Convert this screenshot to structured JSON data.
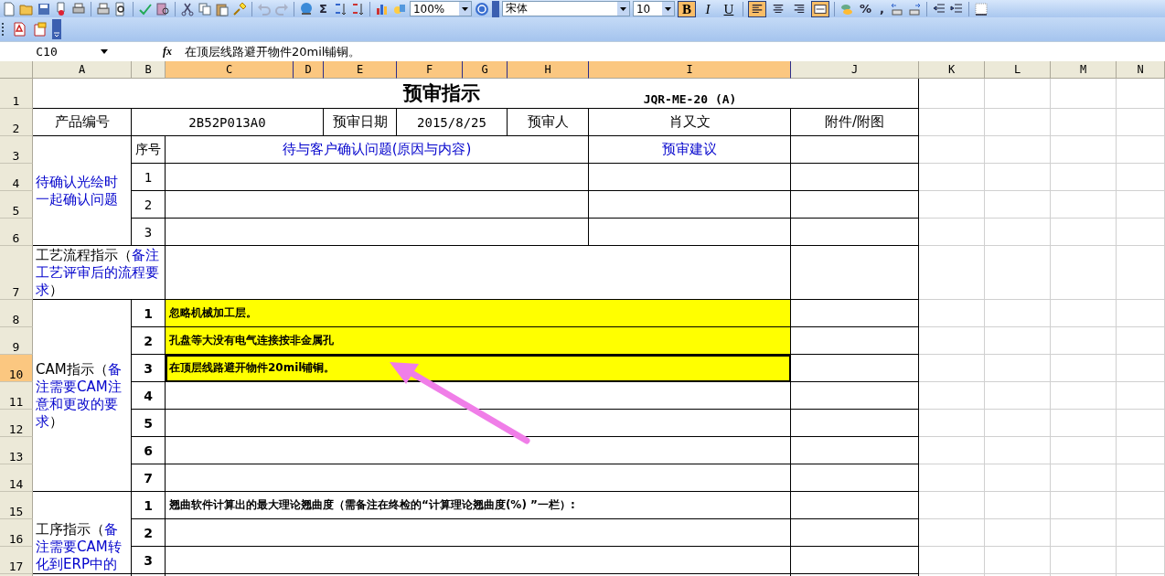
{
  "toolbar": {
    "sum_symbol": "Σ",
    "zoom": "100%",
    "font_name": "宋体",
    "font_size": "10",
    "style_buttons": [
      {
        "label": "B",
        "selected": true
      },
      {
        "label": "I",
        "selected": false
      },
      {
        "label": "U",
        "selected": false
      }
    ],
    "align_buttons": [
      {
        "kind": "left",
        "selected": true
      },
      {
        "kind": "center",
        "selected": false
      },
      {
        "kind": "right",
        "selected": false
      },
      {
        "kind": "merge",
        "selected": true
      }
    ],
    "number_buttons": [
      "%",
      ","
    ]
  },
  "formula_bar": {
    "name_box": "C10",
    "fx": "fx",
    "formula": "在顶层线路避开物件20mil铺铜。"
  },
  "columns": [
    {
      "label": "A",
      "selected": false
    },
    {
      "label": "B",
      "selected": false
    },
    {
      "label": "C",
      "selected": true
    },
    {
      "label": "D",
      "selected": true
    },
    {
      "label": "E",
      "selected": true
    },
    {
      "label": "F",
      "selected": true
    },
    {
      "label": "G",
      "selected": true
    },
    {
      "label": "H",
      "selected": true
    },
    {
      "label": "I",
      "selected": true
    },
    {
      "label": "J",
      "selected": false
    },
    {
      "label": "K",
      "selected": false
    },
    {
      "label": "L",
      "selected": false
    },
    {
      "label": "M",
      "selected": false
    },
    {
      "label": "N",
      "selected": false
    }
  ],
  "rows": [
    {
      "label": "1",
      "selected": false
    },
    {
      "label": "2",
      "selected": false
    },
    {
      "label": "3",
      "selected": false
    },
    {
      "label": "4",
      "selected": false
    },
    {
      "label": "5",
      "selected": false
    },
    {
      "label": "6",
      "selected": false
    },
    {
      "label": "7",
      "selected": false
    },
    {
      "label": "8",
      "selected": false
    },
    {
      "label": "9",
      "selected": false
    },
    {
      "label": "10",
      "selected": true
    },
    {
      "label": "11",
      "selected": false
    },
    {
      "label": "12",
      "selected": false
    },
    {
      "label": "13",
      "selected": false
    },
    {
      "label": "14",
      "selected": false
    },
    {
      "label": "15",
      "selected": false
    },
    {
      "label": "16",
      "selected": false
    },
    {
      "label": "17",
      "selected": false
    }
  ],
  "sheet": {
    "title": "预审指示",
    "doc_code": "JQR-ME-20 (A)",
    "product_label": "产品编号",
    "product_value": "2B52P013A0",
    "date_label": "预审日期",
    "date_value": "2015/8/25",
    "reviewer_label": "预审人",
    "reviewer_value": "肖又文",
    "attachment_label": "附件/附图",
    "confirm_section": {
      "label": "待确认光绘时一起确认问题",
      "seq_header": "序号",
      "issue_header": "待与客户确认问题(原因与内容)",
      "suggestion_header": "预审建议",
      "numbers": [
        "1",
        "2",
        "3"
      ]
    },
    "process_section": {
      "label_parts": [
        {
          "text": "工艺流程指示（",
          "kind": "plain"
        },
        {
          "text": "备注工艺评审后的流程要求",
          "kind": "note"
        },
        {
          "text": "）",
          "kind": "plain"
        }
      ]
    },
    "cam_section": {
      "label_parts": [
        {
          "text": "CAM指示（",
          "kind": "plain"
        },
        {
          "text": "备注需要CAM注意和更改的要求",
          "kind": "note"
        },
        {
          "text": "）",
          "kind": "plain"
        }
      ],
      "items": [
        {
          "number": "1",
          "text": "忽略机械加工层。",
          "highlighted": true,
          "selected": false
        },
        {
          "number": "2",
          "text": "孔盘等大没有电气连接按非金属孔",
          "highlighted": true,
          "selected": false
        },
        {
          "number": "3",
          "text": "在顶层线路避开物件20mil铺铜。",
          "highlighted": true,
          "selected": true
        },
        {
          "number": "4",
          "highlighted": false,
          "selected": false
        },
        {
          "number": "5",
          "highlighted": false,
          "selected": false
        },
        {
          "number": "6",
          "highlighted": false,
          "selected": false
        },
        {
          "number": "7",
          "highlighted": false,
          "selected": false
        }
      ]
    },
    "operation_section": {
      "label_parts": [
        {
          "text": "工序指示（",
          "kind": "plain"
        },
        {
          "text": "备注需要CAM转化到ERP中的",
          "kind": "note"
        }
      ],
      "items": [
        {
          "number": "1",
          "text": "翘曲软件计算出的最大理论翘曲度（需备注在终检的“计算理论翘曲度(%) ”一栏）:"
        },
        {
          "number": "2"
        },
        {
          "number": "3"
        }
      ]
    }
  }
}
